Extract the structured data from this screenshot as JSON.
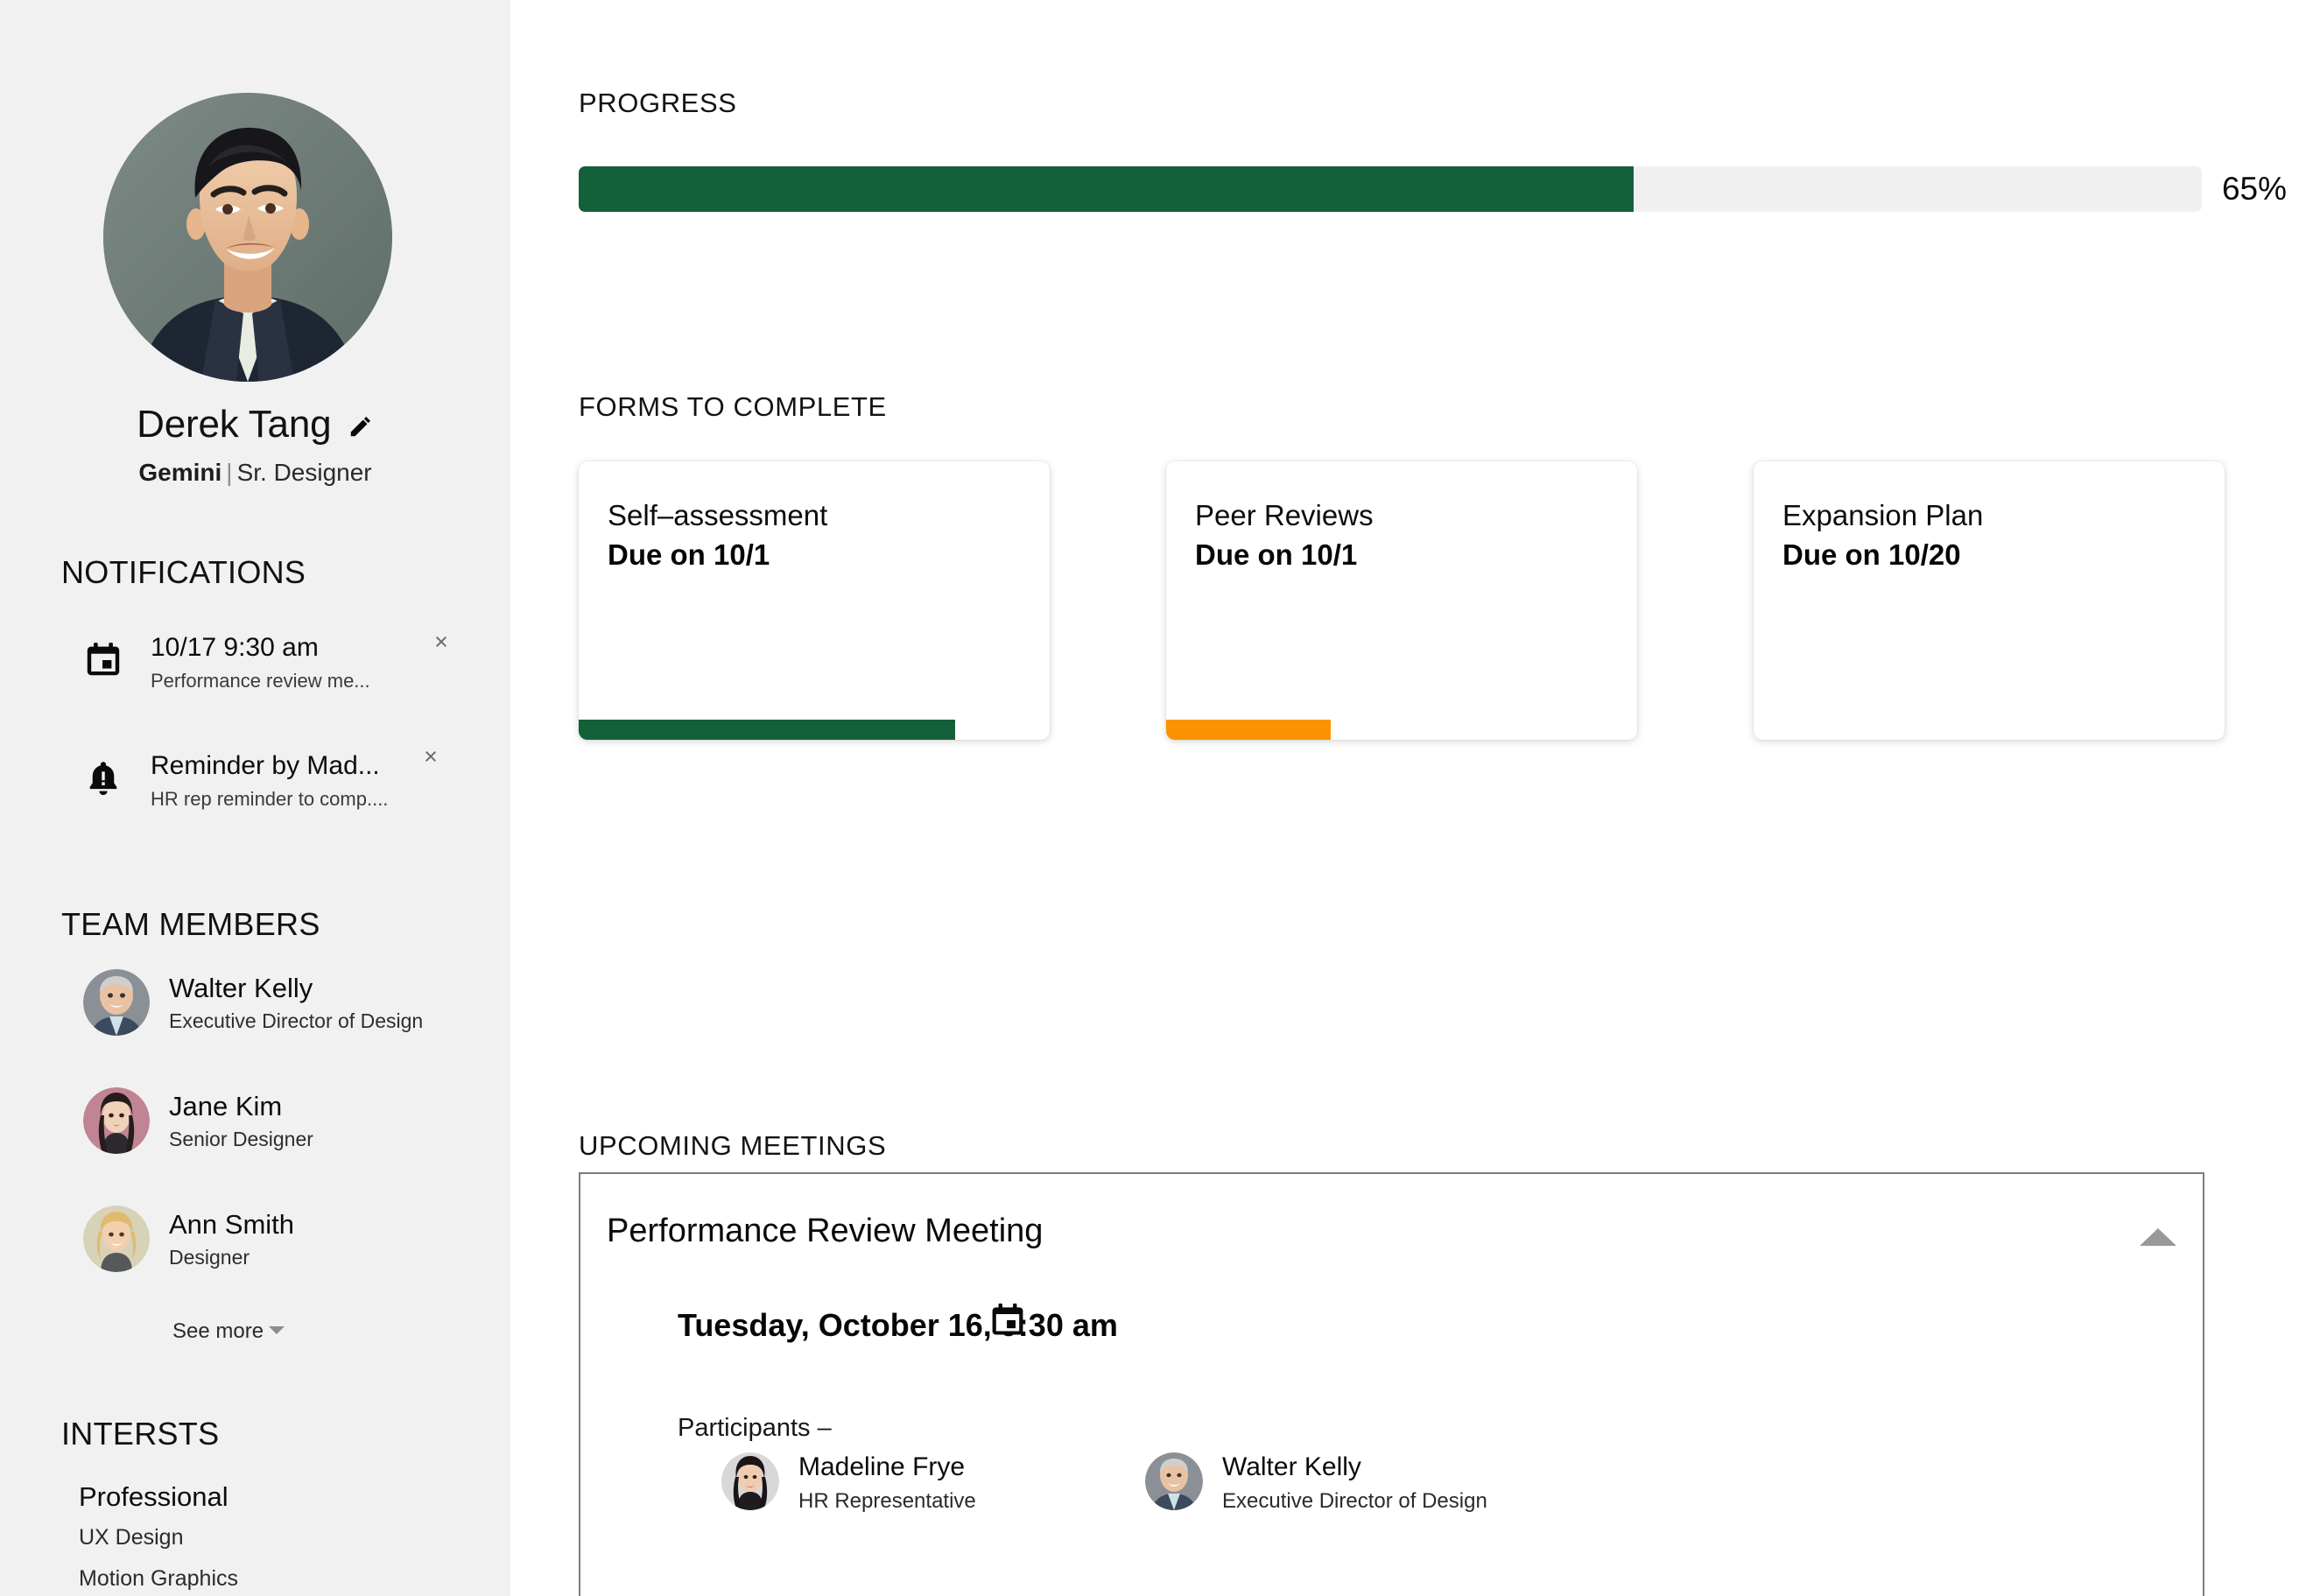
{
  "colors": {
    "sidebar_bg": "#f1f1f1",
    "accent_green": "#14603a",
    "accent_orange": "#fb9200",
    "track_gray": "#f0f0f0",
    "panel_border": "#7c7c7c"
  },
  "profile": {
    "name": "Derek Tang",
    "team": "Gemini",
    "separator": "|",
    "role": "Sr. Designer",
    "edit_icon": "pencil-icon"
  },
  "sidebar": {
    "notifications_heading": "NOTIFICATIONS",
    "notifications": [
      {
        "icon": "calendar-icon",
        "title": "10/17 9:30 am",
        "description": "Performance review me...",
        "close_label": "×"
      },
      {
        "icon": "bell-alert-icon",
        "title": "Reminder by Mad...",
        "description": "HR rep reminder to comp....",
        "close_label": "×"
      }
    ],
    "team_heading": "TEAM MEMBERS",
    "team_members": [
      {
        "name": "Walter Kelly",
        "role": "Executive Director of Design"
      },
      {
        "name": "Jane Kim",
        "role": "Senior Designer"
      },
      {
        "name": "Ann Smith",
        "role": "Designer"
      }
    ],
    "see_more_label": "See more",
    "interests_heading": "INTERSTS",
    "interest_category": "Professional",
    "interests": [
      "UX Design",
      "Motion Graphics"
    ]
  },
  "main": {
    "progress_heading": "PROGRESS",
    "progress_percent_label": "65%",
    "progress_percent_value": 65,
    "forms_heading": "FORMS TO COMPLETE",
    "forms": [
      {
        "title": "Self–assessment",
        "due": "Due on 10/1",
        "bar_percent": 80,
        "bar_color": "#14603a"
      },
      {
        "title": "Peer Reviews",
        "due": "Due on 10/1",
        "bar_percent": 35,
        "bar_color": "#fb9200"
      },
      {
        "title": "Expansion Plan",
        "due": "Due on 10/20",
        "bar_percent": 0,
        "bar_color": "#14603a"
      }
    ],
    "meetings_heading": "UPCOMING MEETINGS",
    "meeting": {
      "title": "Performance Review Meeting",
      "datetime": "Tuesday, October 16, 9:30 am",
      "calendar_icon": "calendar-icon",
      "collapse_icon": "chevron-up-icon",
      "participants_label": "Participants –",
      "participants": [
        {
          "name": "Madeline Frye",
          "role": "HR Representative"
        },
        {
          "name": "Walter Kelly",
          "role": "Executive Director of Design"
        }
      ]
    }
  }
}
